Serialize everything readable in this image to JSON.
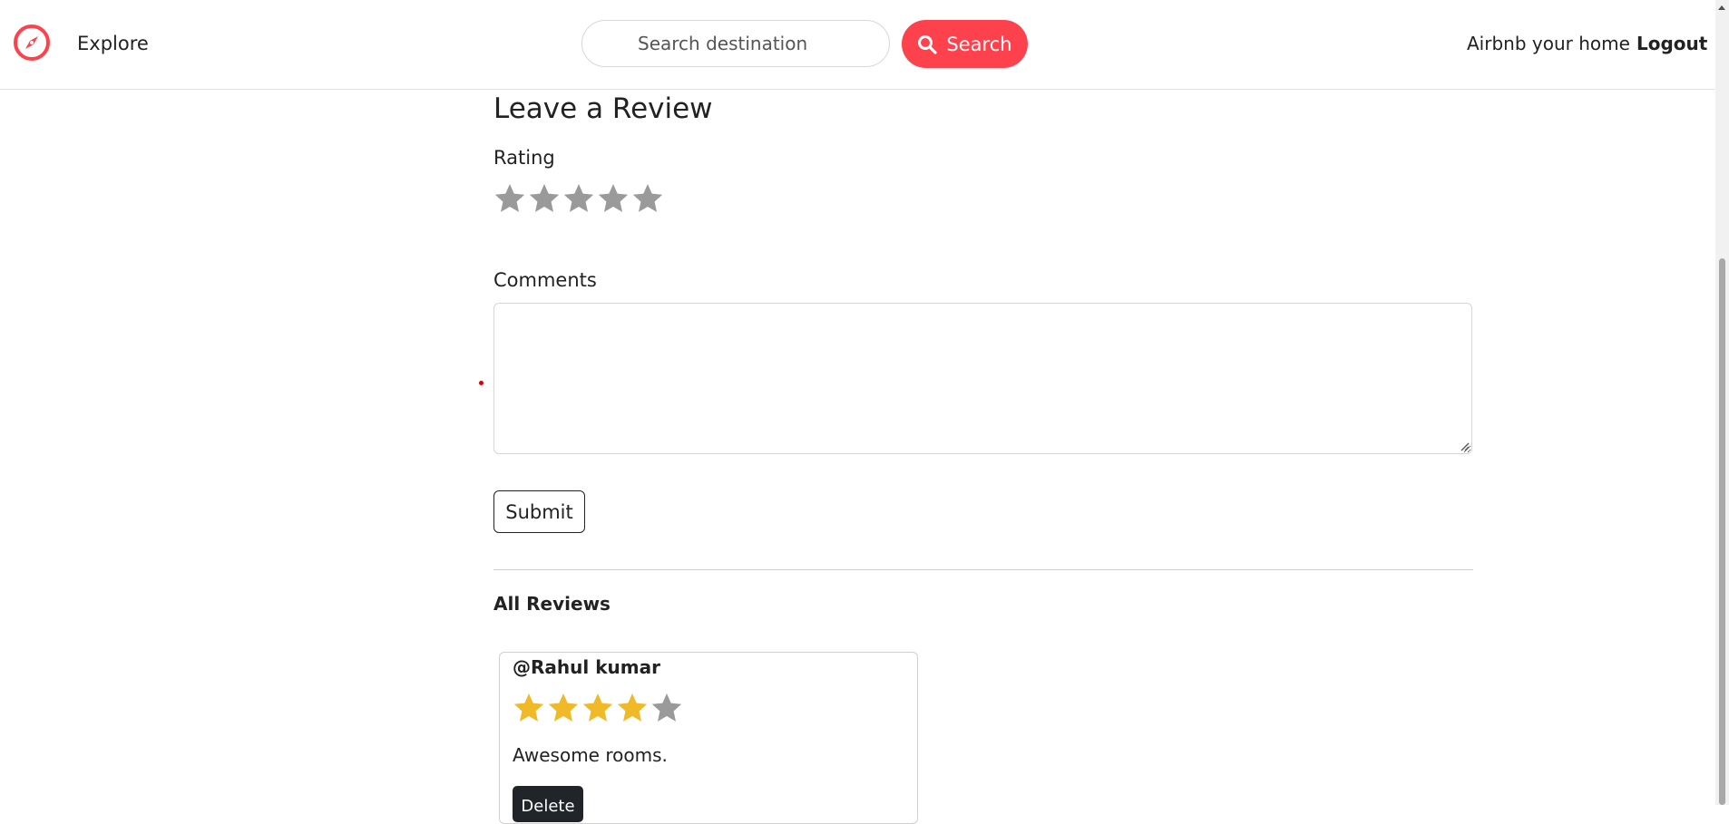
{
  "navbar": {
    "brand_icon": "compass-icon",
    "explore_label": "Explore",
    "search_placeholder": "Search destination",
    "search_button_label": "Search",
    "host_label": "Airbnb your home",
    "logout_label": "Logout"
  },
  "review_form": {
    "heading": "Leave a Review",
    "rating_label": "Rating",
    "rating_value": 0,
    "rating_max": 5,
    "comments_label": "Comments",
    "comments_value": "",
    "submit_label": "Submit"
  },
  "reviews_section": {
    "title": "All Reviews",
    "reviews": [
      {
        "author": "@Rahul kumar",
        "rating": 4,
        "rating_max": 5,
        "comment": "Awesome rooms.",
        "delete_label": "Delete"
      }
    ]
  },
  "colors": {
    "brand": "#fe424d",
    "star_filled": "#f0b928",
    "star_empty": "#9a9a9a",
    "dark_button": "#212529"
  }
}
